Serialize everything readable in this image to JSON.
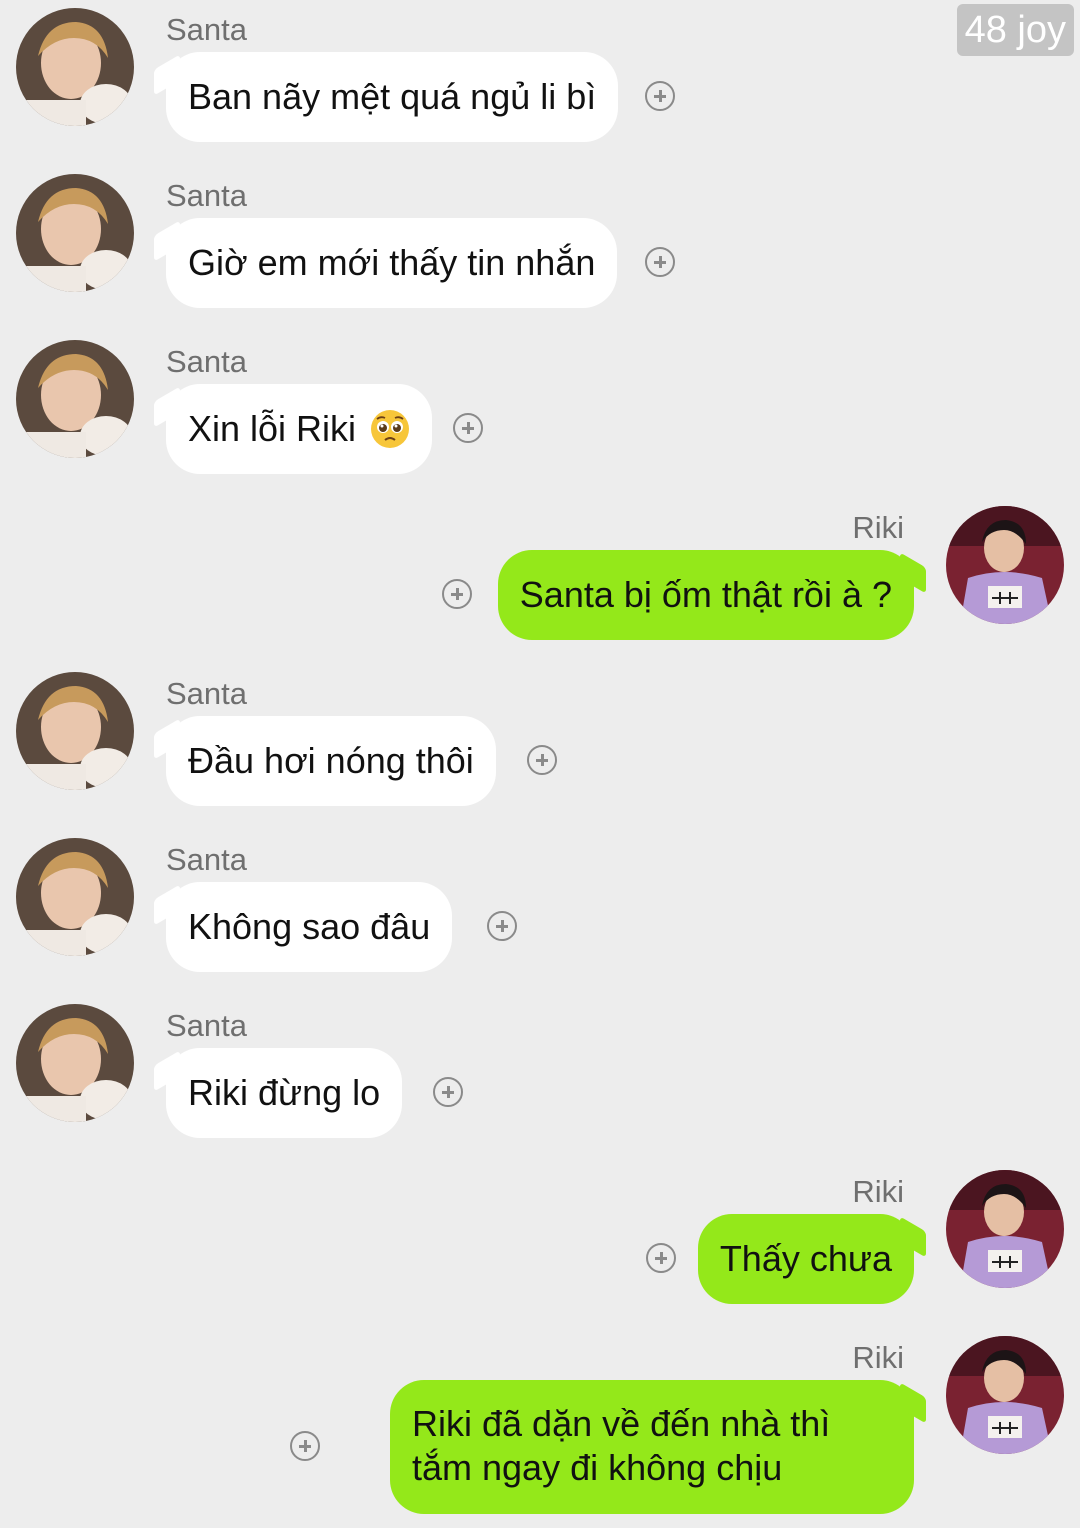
{
  "watermark": "48 joy",
  "messages": [
    {
      "side": "left",
      "sender": "Santa",
      "text": "Ban nãy mệt quá ngủ li bì"
    },
    {
      "side": "left",
      "sender": "Santa",
      "text": "Giờ em mới thấy tin nhắn"
    },
    {
      "side": "left",
      "sender": "Santa",
      "text": "Xin lỗi Riki"
    },
    {
      "side": "right",
      "sender": "Riki",
      "text": "Santa bị ốm thật rồi à ?"
    },
    {
      "side": "left",
      "sender": "Santa",
      "text": "Đầu hơi nóng thôi"
    },
    {
      "side": "left",
      "sender": "Santa",
      "text": "Không sao đâu"
    },
    {
      "side": "left",
      "sender": "Santa",
      "text": "Riki đừng lo"
    },
    {
      "side": "right",
      "sender": "Riki",
      "text": "Thấy chưa"
    },
    {
      "side": "right",
      "sender": "Riki",
      "text": "Riki đã dặn về đến nhà thì tắm ngay đi không chịu"
    }
  ],
  "icons": {
    "add": "plus-circle-icon",
    "emoji": "pleading-face-emoji"
  },
  "colors": {
    "background": "#ededed",
    "incoming_bubble": "#ffffff",
    "outgoing_bubble": "#94e81a",
    "sender_text": "#6f6f6f"
  }
}
